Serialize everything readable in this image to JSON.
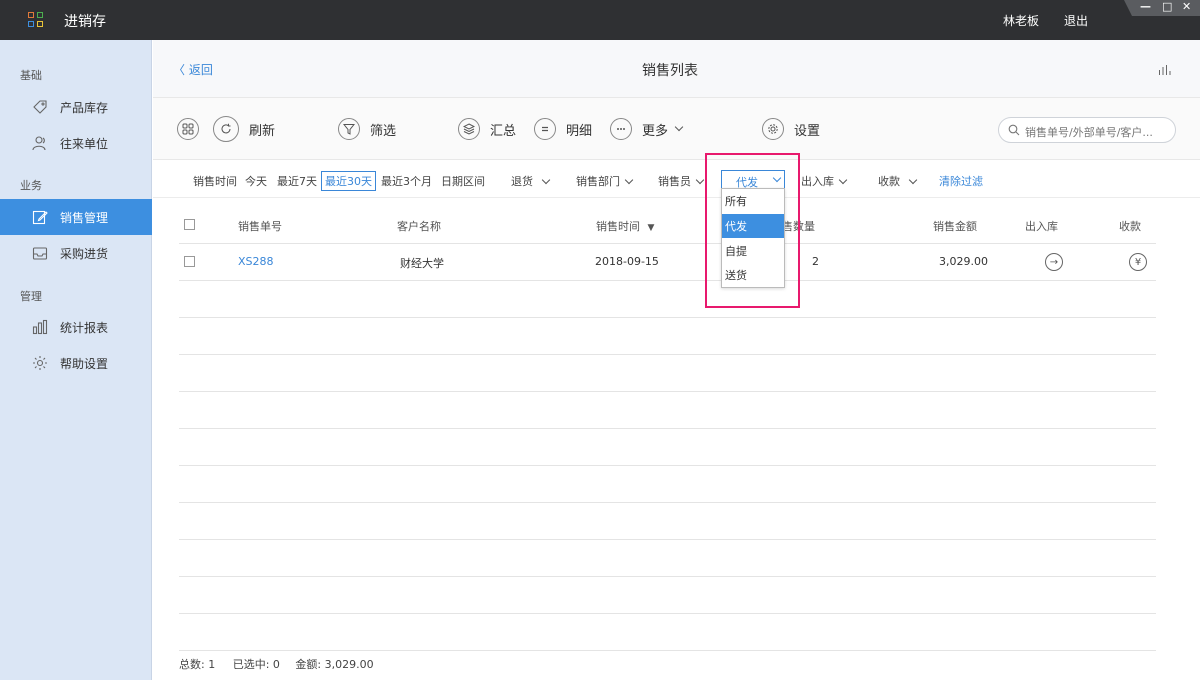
{
  "app": {
    "title": "进销存",
    "user": "林老板",
    "logout": "退出"
  },
  "window_controls": {
    "minimize": "—",
    "maximize": "□",
    "close": "✕"
  },
  "sidebar": {
    "groups": [
      {
        "label": "基础"
      },
      {
        "label": "业务"
      },
      {
        "label": "管理"
      }
    ],
    "items": [
      {
        "label": "产品库存",
        "icon": "tag-icon"
      },
      {
        "label": "往来单位",
        "icon": "contacts-icon"
      },
      {
        "label": "销售管理",
        "icon": "edit-icon",
        "active": true
      },
      {
        "label": "采购进货",
        "icon": "inbox-icon"
      },
      {
        "label": "统计报表",
        "icon": "bar-chart-icon"
      },
      {
        "label": "帮助设置",
        "icon": "gear-icon"
      }
    ]
  },
  "header": {
    "back": "返回",
    "title": "销售列表"
  },
  "toolbar": {
    "refresh": "刷新",
    "filter": "筛选",
    "summary": "汇总",
    "detail": "明细",
    "more": "更多",
    "settings": "设置",
    "search_placeholder": "销售单号/外部单号/客户..."
  },
  "filters": {
    "time_label": "销售时间",
    "today": "今天",
    "last7": "最近7天",
    "last30": "最近30天",
    "last3m": "最近3个月",
    "range": "日期区间",
    "return": "退货",
    "dept": "销售部门",
    "salesman": "销售员",
    "ship_selected": "代发",
    "inout": "出入库",
    "payment": "收款",
    "clear": "清除过滤"
  },
  "dropdown": {
    "options": [
      "所有",
      "代发",
      "自提",
      "送货"
    ],
    "active_index": 1
  },
  "table": {
    "headers": {
      "order_no": "销售单号",
      "customer": "客户名称",
      "time": "销售时间",
      "sort_marker": "▼",
      "qty": "销售数量",
      "amount": "销售金额",
      "inout": "出入库",
      "payment": "收款"
    },
    "rows": [
      {
        "order_no": "XS288",
        "customer": "财经大学",
        "time": "2018-09-15",
        "qty": "2",
        "amount": "3,029.00",
        "inout_icon": "→",
        "payment_icon": "¥"
      }
    ]
  },
  "footer": {
    "total": "总数:  1",
    "selected": "已选中:  0",
    "amount": "金额:  3,029.00"
  },
  "colors": {
    "accent": "#3d8fe0",
    "link": "#3a87d8",
    "highlight": "#e8196d",
    "titlebar": "#2f3033",
    "sidebar": "#dbe6f5"
  }
}
